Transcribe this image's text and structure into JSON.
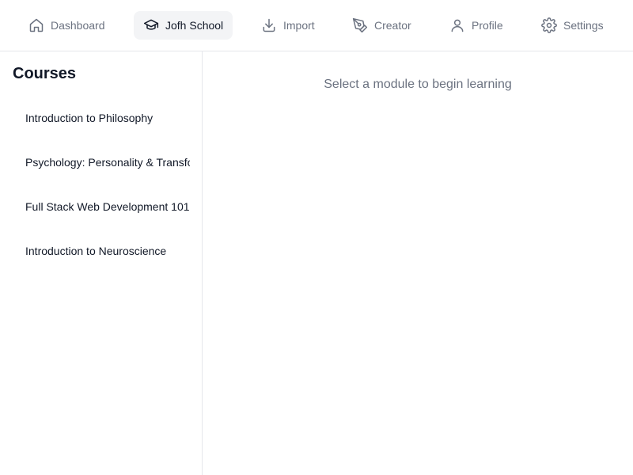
{
  "nav": {
    "items": [
      {
        "label": "Dashboard",
        "icon": "home-icon"
      },
      {
        "label": "Jofh School",
        "icon": "graduation-cap-icon",
        "active": true
      },
      {
        "label": "Import",
        "icon": "download-icon"
      },
      {
        "label": "Creator",
        "icon": "pen-tool-icon"
      },
      {
        "label": "Profile",
        "icon": "user-icon"
      },
      {
        "label": "Settings",
        "icon": "gear-icon"
      }
    ]
  },
  "sidebar": {
    "title": "Courses",
    "courses": [
      {
        "label": "Introduction to Philosophy"
      },
      {
        "label": "Psychology: Personality & Transformation"
      },
      {
        "label": "Full Stack Web Development 101"
      },
      {
        "label": "Introduction to Neuroscience"
      }
    ]
  },
  "main": {
    "empty_message": "Select a module to begin learning"
  },
  "colors": {
    "border": "#e5e7eb",
    "muted_text": "#6b7280",
    "active_bg": "#f3f4f6",
    "text": "#111827"
  }
}
